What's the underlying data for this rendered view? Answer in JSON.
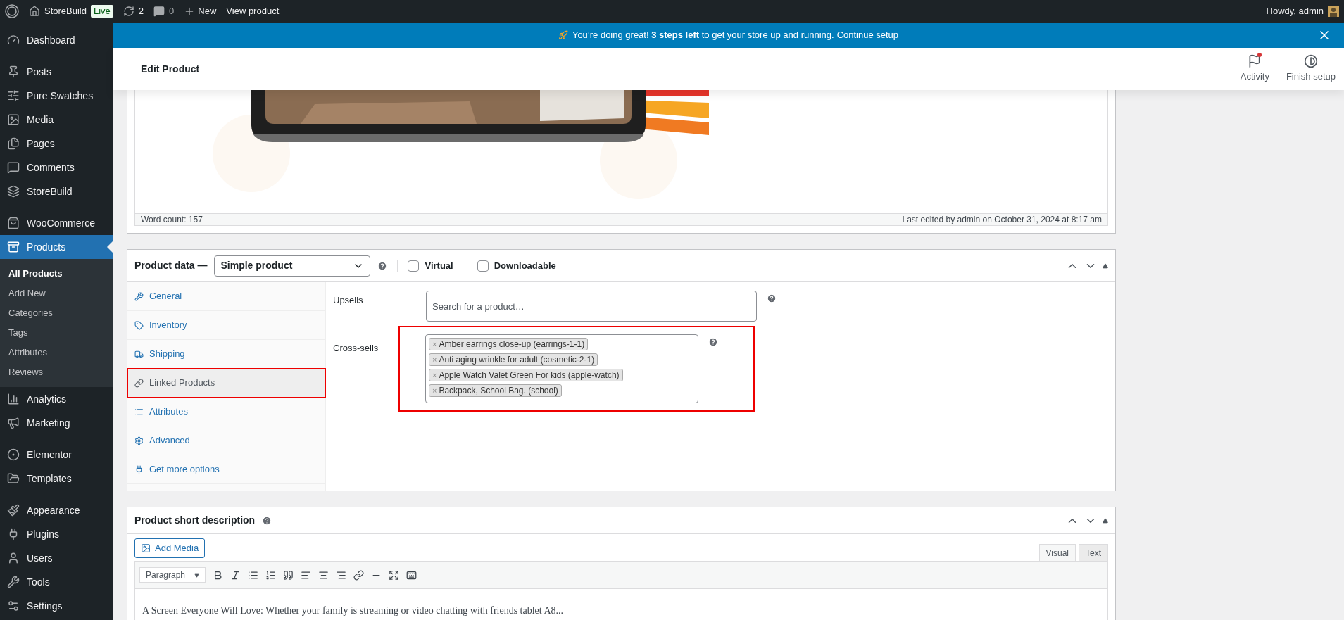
{
  "admin_bar": {
    "site": "StoreBuild",
    "badge": "Live",
    "updates": "2",
    "comments": "0",
    "new": "New",
    "view": "View product",
    "greeting": "Howdy, admin"
  },
  "sidebar": {
    "groups": [
      [
        {
          "label": "Dashboard",
          "selected": false
        }
      ],
      [
        {
          "label": "Posts",
          "selected": false
        },
        {
          "label": "Pure Swatches",
          "selected": false
        },
        {
          "label": "Media",
          "selected": false
        },
        {
          "label": "Pages",
          "selected": false
        },
        {
          "label": "Comments",
          "selected": false
        },
        {
          "label": "StoreBuild",
          "selected": false
        }
      ],
      [
        {
          "label": "WooCommerce",
          "selected": false
        },
        {
          "label": "Products",
          "selected": true,
          "children": [
            {
              "label": "All Products",
              "selected": true
            },
            {
              "label": "Add New",
              "selected": false
            },
            {
              "label": "Categories",
              "selected": false
            },
            {
              "label": "Tags",
              "selected": false
            },
            {
              "label": "Attributes",
              "selected": false
            },
            {
              "label": "Reviews",
              "selected": false
            }
          ]
        },
        {
          "label": "Analytics",
          "selected": false
        },
        {
          "label": "Marketing",
          "selected": false
        }
      ],
      [
        {
          "label": "Elementor",
          "selected": false
        },
        {
          "label": "Templates",
          "selected": false
        }
      ],
      [
        {
          "label": "Appearance",
          "selected": false
        },
        {
          "label": "Plugins",
          "selected": false
        },
        {
          "label": "Users",
          "selected": false
        },
        {
          "label": "Tools",
          "selected": false
        },
        {
          "label": "Settings",
          "selected": false
        }
      ]
    ]
  },
  "notice": {
    "text": "You’re doing great! **3 steps left** to get your store up and running.",
    "link": "Continue setup"
  },
  "header": {
    "title": "Edit Product",
    "actions": [
      {
        "label": "Activity",
        "unread": true
      },
      {
        "label": "Finish setup",
        "unread": false
      }
    ]
  },
  "editor": {
    "word_count": "Word count: 157",
    "last_edited": "Last edited by admin on October 31, 2024 at 8:17 am"
  },
  "product_data": {
    "title": "Product data —",
    "type": "Simple product",
    "virtual": {
      "label": "Virtual",
      "checked": false
    },
    "downloadable": {
      "label": "Downloadable",
      "checked": false
    },
    "tabs": [
      {
        "label": "General",
        "selected": false,
        "highlighted": false
      },
      {
        "label": "Inventory",
        "selected": false,
        "highlighted": false
      },
      {
        "label": "Shipping",
        "selected": false,
        "highlighted": false
      },
      {
        "label": "Linked Products",
        "selected": true,
        "highlighted": true
      },
      {
        "label": "Attributes",
        "selected": false,
        "highlighted": false
      },
      {
        "label": "Advanced",
        "selected": false,
        "highlighted": false
      },
      {
        "label": "Get more options",
        "selected": false,
        "highlighted": false
      }
    ],
    "upsells": {
      "label": "Upsells",
      "placeholder": "Search for a product…"
    },
    "cross_sells": {
      "label": "Cross-sells",
      "highlighted": true,
      "items": [
        {
          "remove": "×",
          "label": "Amber earrings close-up (earrings-1-1)"
        },
        {
          "remove": "×",
          "label": "Anti aging wrinkle for adult (cosmetic-2-1)"
        },
        {
          "remove": "×",
          "label": "Apple Watch Valet Green For kids (apple-watch)"
        },
        {
          "remove": "×",
          "label": "Backpack, School Bag. (school)"
        }
      ]
    }
  },
  "short_description": {
    "title": "Product short description",
    "add_media": "Add Media",
    "tabs": [
      {
        "label": "Visual",
        "selected": true
      },
      {
        "label": "Text",
        "selected": false
      }
    ],
    "format": "Paragraph",
    "text": "A Screen Everyone Will Love: Whether your family is streaming or video chatting with friends tablet A8..."
  }
}
